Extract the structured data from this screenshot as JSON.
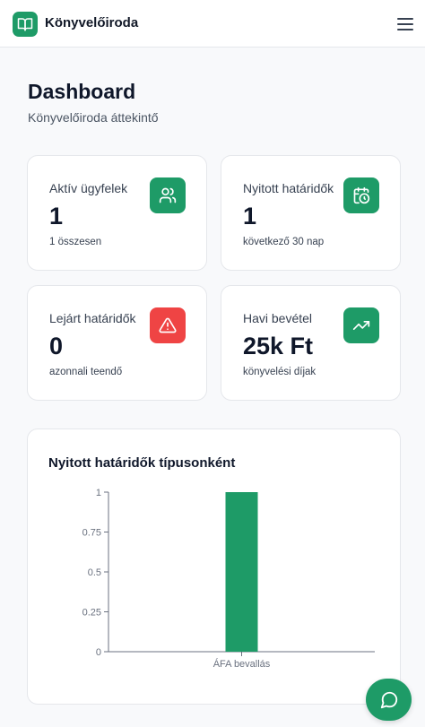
{
  "header": {
    "app_title": "Könyvelőiroda",
    "logo_icon": "book-open-icon",
    "menu_icon": "hamburger-menu-icon"
  },
  "page": {
    "title": "Dashboard",
    "subtitle": "Könyvelőiroda áttekintő"
  },
  "stats": [
    {
      "label": "Aktív ügyfelek",
      "value": "1",
      "sub": "1 összesen",
      "icon": "users-icon",
      "icon_color": "#1e9b67"
    },
    {
      "label": "Nyitott határidők",
      "value": "1",
      "sub": "következő 30 nap",
      "icon": "calendar-clock-icon",
      "icon_color": "#1e9b67"
    },
    {
      "label": "Lejárt határidők",
      "value": "0",
      "sub": "azonnali teendő",
      "icon": "alert-triangle-icon",
      "icon_color": "#ef4444"
    },
    {
      "label": "Havi bevétel",
      "value": "25k Ft",
      "sub": "könyvelési díjak",
      "icon": "trending-up-icon",
      "icon_color": "#1e9b67"
    }
  ],
  "chart": {
    "title": "Nyitott határidők típusonként"
  },
  "chart_data": {
    "type": "bar",
    "categories": [
      "ÁFA bevallás"
    ],
    "values": [
      1
    ],
    "ylim": [
      0,
      1
    ],
    "yticks": [
      "0",
      "0.25",
      "0.5",
      "0.75",
      "1"
    ],
    "title": "Nyitott határidők típusonként",
    "bar_color": "#1e9b67",
    "grid": false
  },
  "fab": {
    "icon": "chat-bubble-icon"
  }
}
